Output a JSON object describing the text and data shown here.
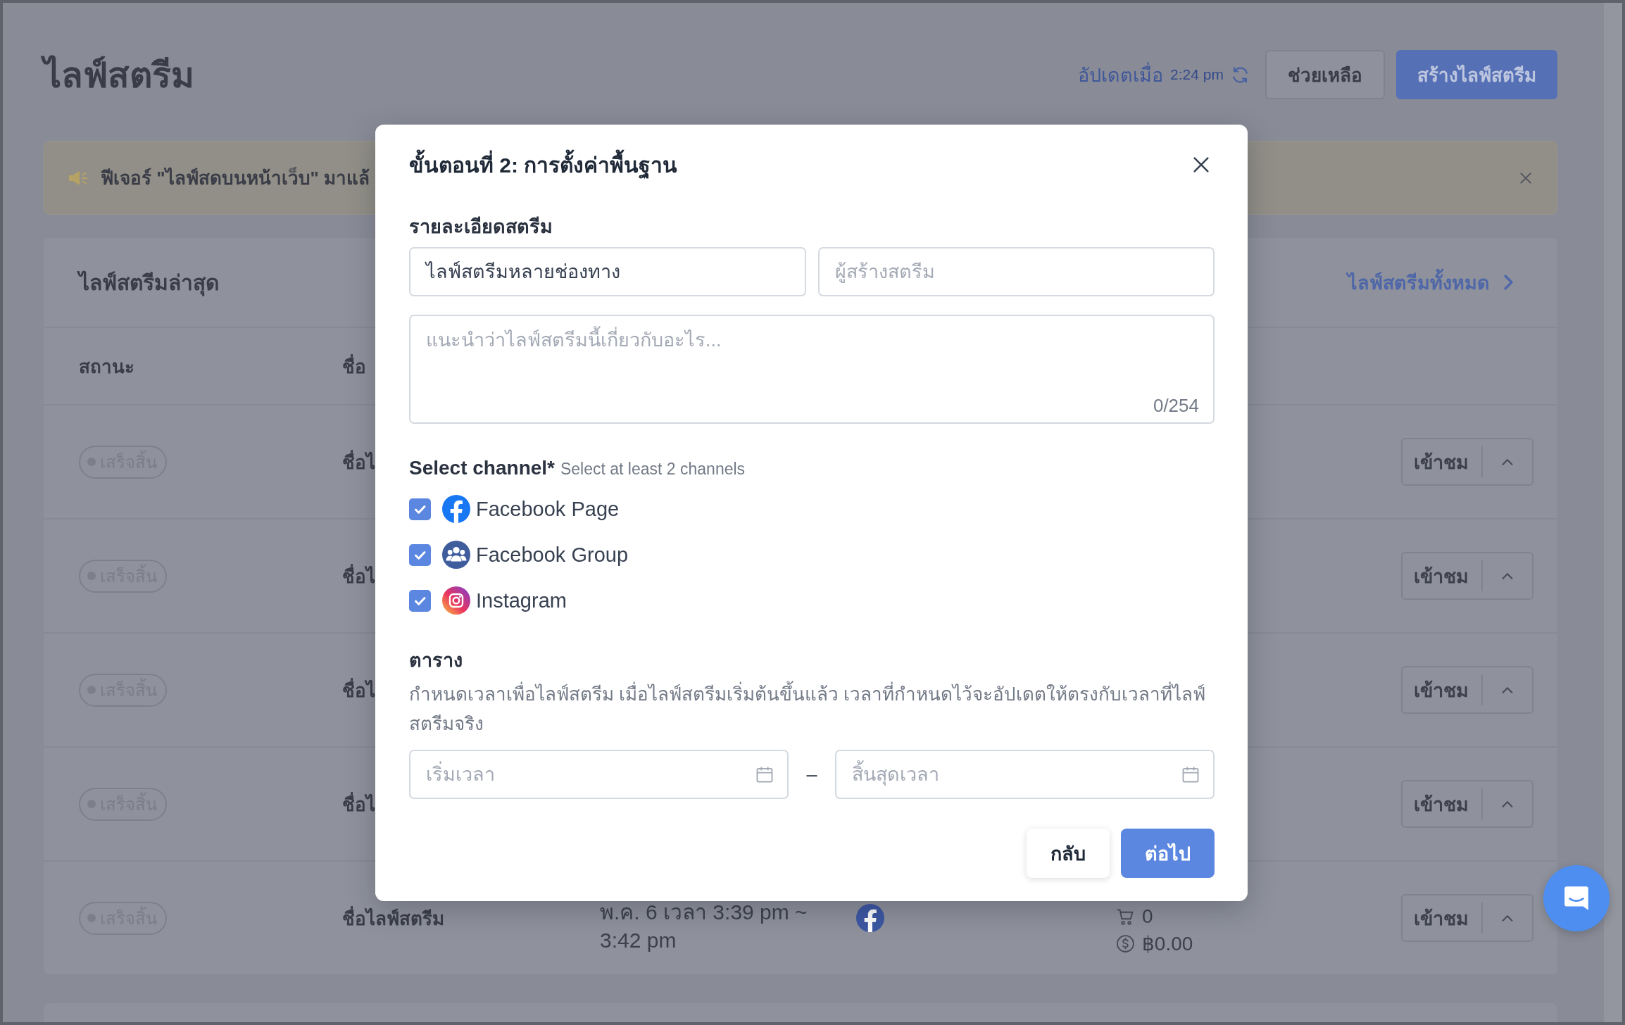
{
  "page": {
    "title": "ไลฟ์สตรีม",
    "updated_label": "อัปเดตเมื่อ",
    "updated_time": "2:24 pm",
    "buttons": [
      {
        "label": "ช่วยเหลือ",
        "kind": "secondary"
      },
      {
        "label": "สร้างไลฟ์สตรีม",
        "kind": "primary"
      }
    ]
  },
  "banner": {
    "text": "ฟีเจอร์ \"ไลฟ์สดบนหน้าเว็บ\" มาแล้"
  },
  "latest": {
    "title": "ไลฟ์สตรีมล่าสุด",
    "link": "ไลฟ์สตรีมทั้งหมด",
    "columns": [
      "สถานะ",
      "ชื่อ"
    ],
    "rows": [
      {
        "kind": "partial",
        "status": "เสร็จสิ้น",
        "name": "ชื่อไ",
        "action": "เข้าชม"
      },
      {
        "kind": "partial",
        "status": "เสร็จสิ้น",
        "name": "ชื่อไ",
        "action": "เข้าชม"
      },
      {
        "kind": "partial",
        "status": "เสร็จสิ้น",
        "name": "ชื่อไ",
        "action": "เข้าชม"
      },
      {
        "kind": "partial",
        "status": "เสร็จสิ้น",
        "name": "ชื่อไ",
        "action": "เข้าชม"
      },
      {
        "kind": "full",
        "status": "เสร็จสิ้น",
        "name": "ชื่อไลฟ์สตรีม",
        "time": "พ.ค. 6 เวลา 3:39 pm ~ 3:42 pm",
        "orders": "0",
        "revenue": "฿0.00",
        "action": "เข้าชม"
      }
    ]
  },
  "modal": {
    "title": "ขั้นตอนที่ 2: การตั้งค่าพื้นฐาน",
    "details_label": "รายละเอียดสตรีม",
    "stream_name": {
      "value": "ไลฟ์สตรีมหลายช่องทาง"
    },
    "creator": {
      "placeholder": "ผู้สร้างสตรีม"
    },
    "description": {
      "placeholder": "แนะนำว่าไลฟ์สตรีมนี้เกี่ยวกับอะไร...",
      "counter": "0/254"
    },
    "channel_label": "Select channel*",
    "channel_hint": "Select at least 2 channels",
    "channels": [
      {
        "kind": "facebook_page",
        "label": "Facebook Page",
        "checked": true
      },
      {
        "kind": "facebook_group",
        "label": "Facebook Group",
        "checked": true
      },
      {
        "kind": "instagram",
        "label": "Instagram",
        "checked": true
      }
    ],
    "schedule_label": "ตาราง",
    "schedule_text": "กำหนดเวลาเพื่อไลฟ์สตรีม เมื่อไลฟ์สตรีมเริ่มต้นขึ้นแล้ว เวลาที่กำหนดไว้จะอัปเดตให้ตรงกับเวลาที่ไลฟ์สตรีมจริง",
    "start": {
      "placeholder": "เริ่มเวลา"
    },
    "separator": "–",
    "end": {
      "placeholder": "สิ้นสุดเวลา"
    },
    "buttons": [
      {
        "label": "กลับ",
        "kind": "secondary"
      },
      {
        "label": "ต่อไป",
        "kind": "primary"
      }
    ]
  }
}
